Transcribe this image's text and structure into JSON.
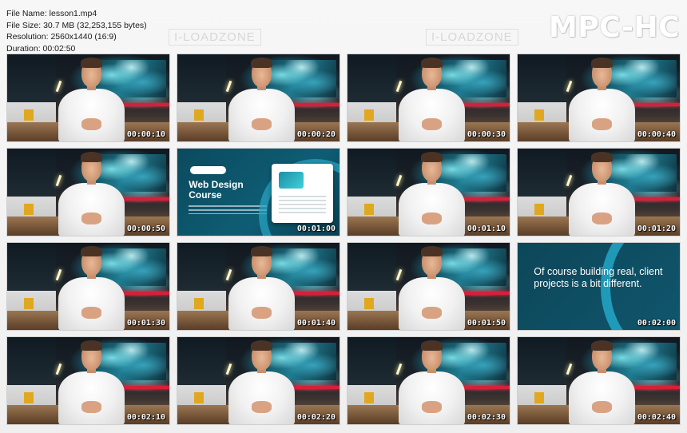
{
  "file_info": {
    "name_line": "File Name: lesson1.mp4",
    "size_line": "File Size: 30.7 MB (32,253,155 bytes)",
    "resolution_line": "Resolution: 2560x1440 (16:9)",
    "duration_line": "Duration: 00:02:50"
  },
  "brand": "MPC-HC",
  "watermark": "I-LOADZONE",
  "frames": [
    {
      "type": "speaker",
      "time": "00:00:10"
    },
    {
      "type": "speaker",
      "time": "00:00:20"
    },
    {
      "type": "speaker",
      "time": "00:00:30"
    },
    {
      "type": "speaker",
      "time": "00:00:40"
    },
    {
      "type": "speaker",
      "time": "00:00:50"
    },
    {
      "type": "course-slide",
      "time": "00:01:00",
      "title_line1": "Web Design",
      "title_line2": "Course"
    },
    {
      "type": "speaker",
      "time": "00:01:10"
    },
    {
      "type": "speaker",
      "time": "00:01:20"
    },
    {
      "type": "speaker",
      "time": "00:01:30"
    },
    {
      "type": "speaker",
      "time": "00:01:40"
    },
    {
      "type": "speaker",
      "time": "00:01:50"
    },
    {
      "type": "quote-slide",
      "time": "00:02:00",
      "quote": "Of course building real, client projects is a bit different."
    },
    {
      "type": "speaker",
      "time": "00:02:10"
    },
    {
      "type": "speaker",
      "time": "00:02:20"
    },
    {
      "type": "speaker",
      "time": "00:02:30"
    },
    {
      "type": "speaker",
      "time": "00:02:40"
    }
  ],
  "colors": {
    "background": "#f4f4f4",
    "brand_text": "#ffffff",
    "slide_bg": "#0e5d74",
    "slide_accent": "#27b3d4",
    "timestamp": "#ffffff"
  }
}
